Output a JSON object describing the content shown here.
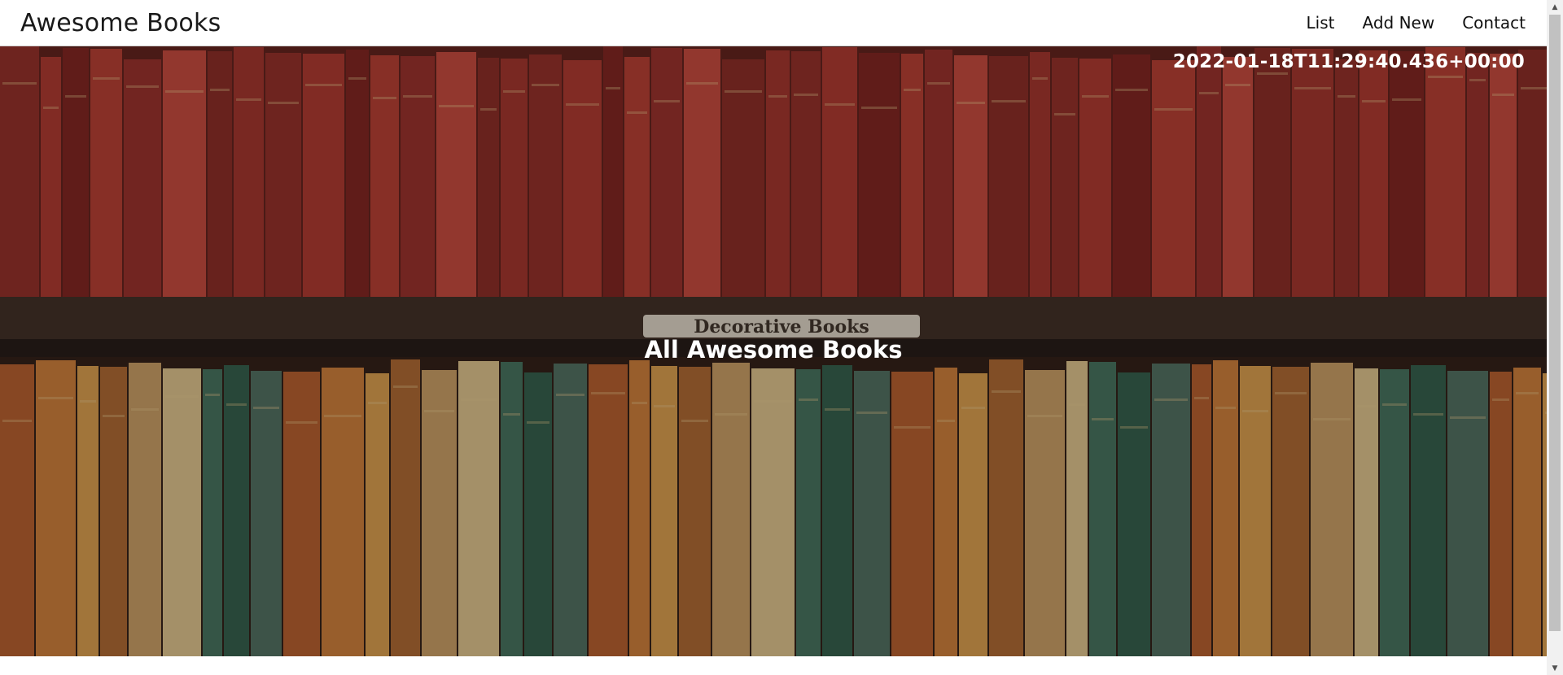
{
  "header": {
    "brand": "Awesome Books",
    "nav": [
      {
        "label": "List"
      },
      {
        "label": "Add New"
      },
      {
        "label": "Contact"
      }
    ]
  },
  "hero": {
    "timestamp": "2022-01-18T11:29:40.436+00:00",
    "title": "All Awesome Books",
    "shelf_label": "Decorative Books"
  },
  "footer": {
    "text": ""
  },
  "colors": {
    "navbar_bg": "#ffffff",
    "hero_text": "#ffffff",
    "top_shelf_books": [
      "#8e2a25",
      "#a8342c",
      "#7a1f1c",
      "#b03a2e",
      "#942c27",
      "#c0443a",
      "#862822",
      "#9d3029"
    ],
    "bottom_shelf_books": [
      "#b05a2a",
      "#c87a36",
      "#d49a4a",
      "#a8642e",
      "#c49a62",
      "#d8c08a",
      "#3f6e5a",
      "#2d5a48",
      "#4a6b5e"
    ]
  },
  "icons": {
    "scroll_up": "scroll-up-arrow-icon",
    "scroll_down": "scroll-down-arrow-icon"
  }
}
